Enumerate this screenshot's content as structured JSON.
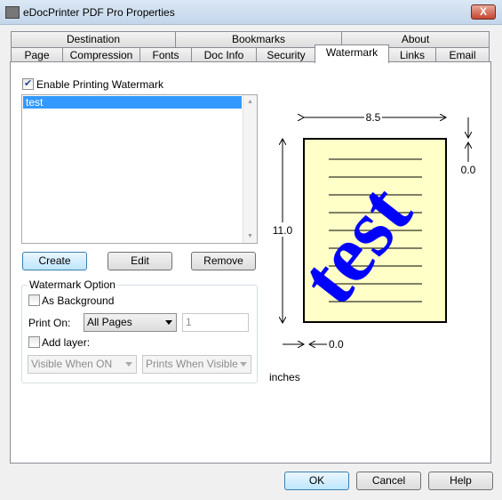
{
  "window": {
    "title": "eDocPrinter PDF Pro Properties",
    "close": "X"
  },
  "tabs_row1": [
    "Destination",
    "Bookmarks",
    "About"
  ],
  "tabs_row2": [
    "Page",
    "Compression",
    "Fonts",
    "Doc Info",
    "Security",
    "Watermark",
    "Links",
    "Email"
  ],
  "active_tab": "Watermark",
  "enable_watermark": {
    "label": "Enable Printing Watermark",
    "checked": true
  },
  "watermark_list": {
    "items": [
      "test"
    ],
    "selected": "test"
  },
  "buttons": {
    "create": "Create",
    "edit": "Edit",
    "remove": "Remove"
  },
  "watermark_option": {
    "title": "Watermark Option",
    "as_background": {
      "label": "As Background",
      "checked": false
    },
    "print_on": {
      "label": "Print On:",
      "value": "All Pages",
      "page_value": "1"
    },
    "add_layer": {
      "label": "Add layer:",
      "checked": false
    },
    "visibility": "Visible When ON",
    "print_mode": "Prints When Visible"
  },
  "preview": {
    "width": "8.5",
    "height": "11.0",
    "top_offset": "0.0",
    "left_offset": "0.0",
    "units": "inches",
    "watermark_text": "test",
    "paper_color": "#ffffc8",
    "watermark_color": "#0000ff"
  },
  "footer": {
    "ok": "OK",
    "cancel": "Cancel",
    "help": "Help"
  }
}
